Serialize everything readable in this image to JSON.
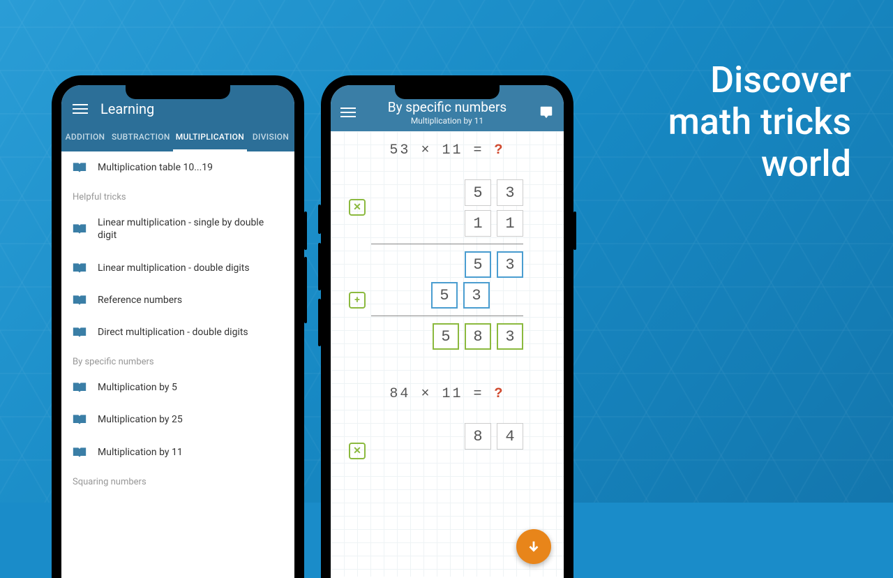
{
  "headline": {
    "line1": "Discover",
    "line2": "math tricks",
    "line3": "world"
  },
  "phone1": {
    "title": "Learning",
    "tabs": [
      "ADDITION",
      "SUBTRACTION",
      "MULTIPLICATION",
      "DIVISION"
    ],
    "activeTab": 2,
    "firstItem": "Multiplication table 10...19",
    "sections": [
      {
        "header": "Helpful tricks",
        "items": [
          "Linear multiplication - single by double digit",
          "Linear multiplication - double digits",
          "Reference numbers",
          "Direct multiplication - double digits"
        ]
      },
      {
        "header": "By specific numbers",
        "items": [
          "Multiplication by 5",
          "Multiplication by 25",
          "Multiplication by 11"
        ]
      },
      {
        "header": "Squaring numbers",
        "items": []
      }
    ]
  },
  "phone2": {
    "title": "By specific numbers",
    "subtitle": "Multiplication by 11",
    "problem1": {
      "a": "53",
      "op": "×",
      "b": "11",
      "eq": "=",
      "q": "?",
      "row1": [
        "5",
        "3"
      ],
      "row2": [
        "1",
        "1"
      ],
      "step1": [
        "5",
        "3"
      ],
      "step2": [
        "5",
        "3"
      ],
      "result": [
        "5",
        "8",
        "3"
      ]
    },
    "problem2": {
      "a": "84",
      "op": "×",
      "b": "11",
      "eq": "=",
      "q": "?",
      "row1": [
        "8",
        "4"
      ]
    },
    "ops": {
      "mult": "✕",
      "plus": "+"
    }
  }
}
